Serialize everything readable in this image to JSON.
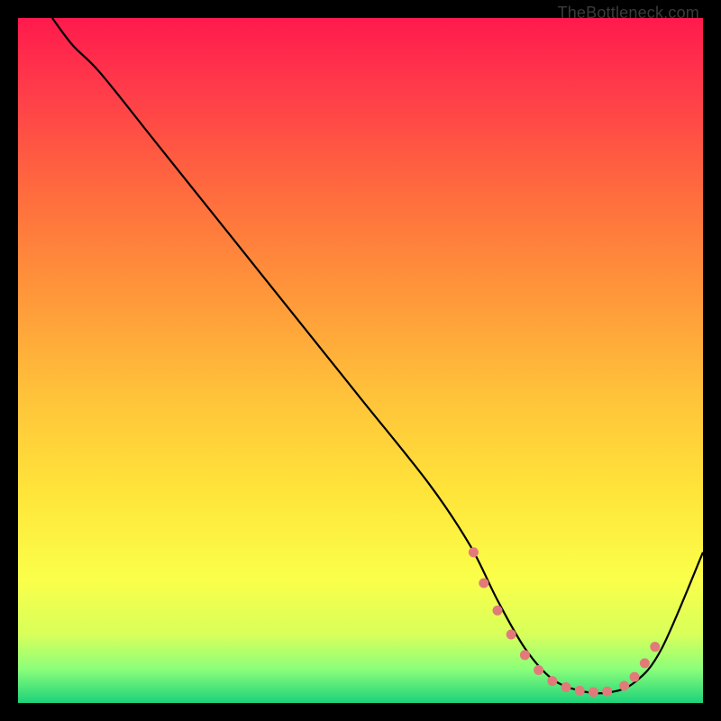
{
  "attribution": "TheBottleneck.com",
  "colors": {
    "frame": "#000000",
    "curve": "#000000",
    "marker": "#e27a7a",
    "gradient_stops": [
      {
        "offset": 0.0,
        "color": "#ff1a4d"
      },
      {
        "offset": 0.1,
        "color": "#ff3a4a"
      },
      {
        "offset": 0.25,
        "color": "#ff6a3e"
      },
      {
        "offset": 0.4,
        "color": "#ff963a"
      },
      {
        "offset": 0.55,
        "color": "#ffc23a"
      },
      {
        "offset": 0.7,
        "color": "#ffe63a"
      },
      {
        "offset": 0.82,
        "color": "#faff4a"
      },
      {
        "offset": 0.9,
        "color": "#d8ff5a"
      },
      {
        "offset": 0.95,
        "color": "#8cff7a"
      },
      {
        "offset": 1.0,
        "color": "#1cd27a"
      }
    ]
  },
  "chart_data": {
    "type": "line",
    "title": "",
    "xlabel": "",
    "ylabel": "",
    "xlim": [
      0,
      100
    ],
    "ylim": [
      0,
      100
    ],
    "series": [
      {
        "name": "curve",
        "x": [
          5,
          8,
          12,
          20,
          30,
          40,
          50,
          60,
          66,
          70,
          74,
          78,
          82,
          86,
          90,
          94,
          100
        ],
        "y": [
          100,
          96,
          92,
          82,
          69.5,
          57,
          44.5,
          32,
          23,
          15,
          8,
          3.5,
          1.8,
          1.5,
          3,
          8,
          22
        ]
      }
    ],
    "markers": {
      "name": "highlight-points",
      "x": [
        66.5,
        68,
        70,
        72,
        74,
        76,
        78,
        80,
        82,
        84,
        86,
        88.5,
        90,
        91.5,
        93
      ],
      "y": [
        22,
        17.5,
        13.5,
        10,
        7,
        4.8,
        3.2,
        2.3,
        1.8,
        1.6,
        1.7,
        2.5,
        3.8,
        5.8,
        8.2
      ]
    }
  }
}
